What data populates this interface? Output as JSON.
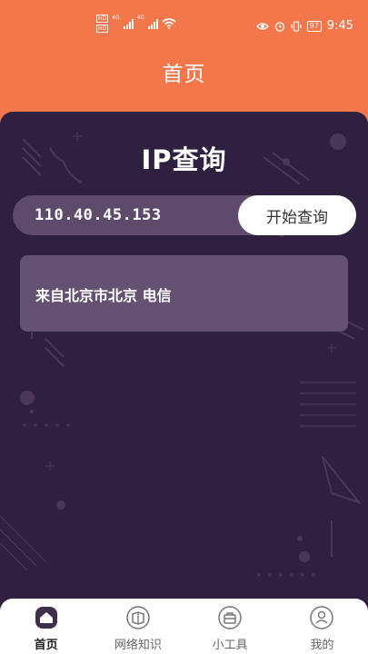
{
  "status_bar": {
    "hd1": "HD",
    "hd2": "HD",
    "lte1": "4G",
    "lte2": "4G",
    "battery": "97",
    "time": "9:45"
  },
  "header": {
    "title": "首页"
  },
  "main": {
    "heading": "IP查询",
    "ip_value": "110.40.45.153",
    "query_button": "开始查询",
    "result": "来自北京市北京 电信"
  },
  "bottom_nav": {
    "items": [
      {
        "label": "首页",
        "icon": "home-icon",
        "active": true
      },
      {
        "label": "网络知识",
        "icon": "book-icon",
        "active": false
      },
      {
        "label": "小工具",
        "icon": "toolbox-icon",
        "active": false
      },
      {
        "label": "我的",
        "icon": "user-icon",
        "active": false
      }
    ]
  },
  "colors": {
    "header_bg": "#f4774b",
    "panel_bg": "#30203f",
    "input_bg": "#5e4a6b",
    "card_bg": "#655171"
  }
}
